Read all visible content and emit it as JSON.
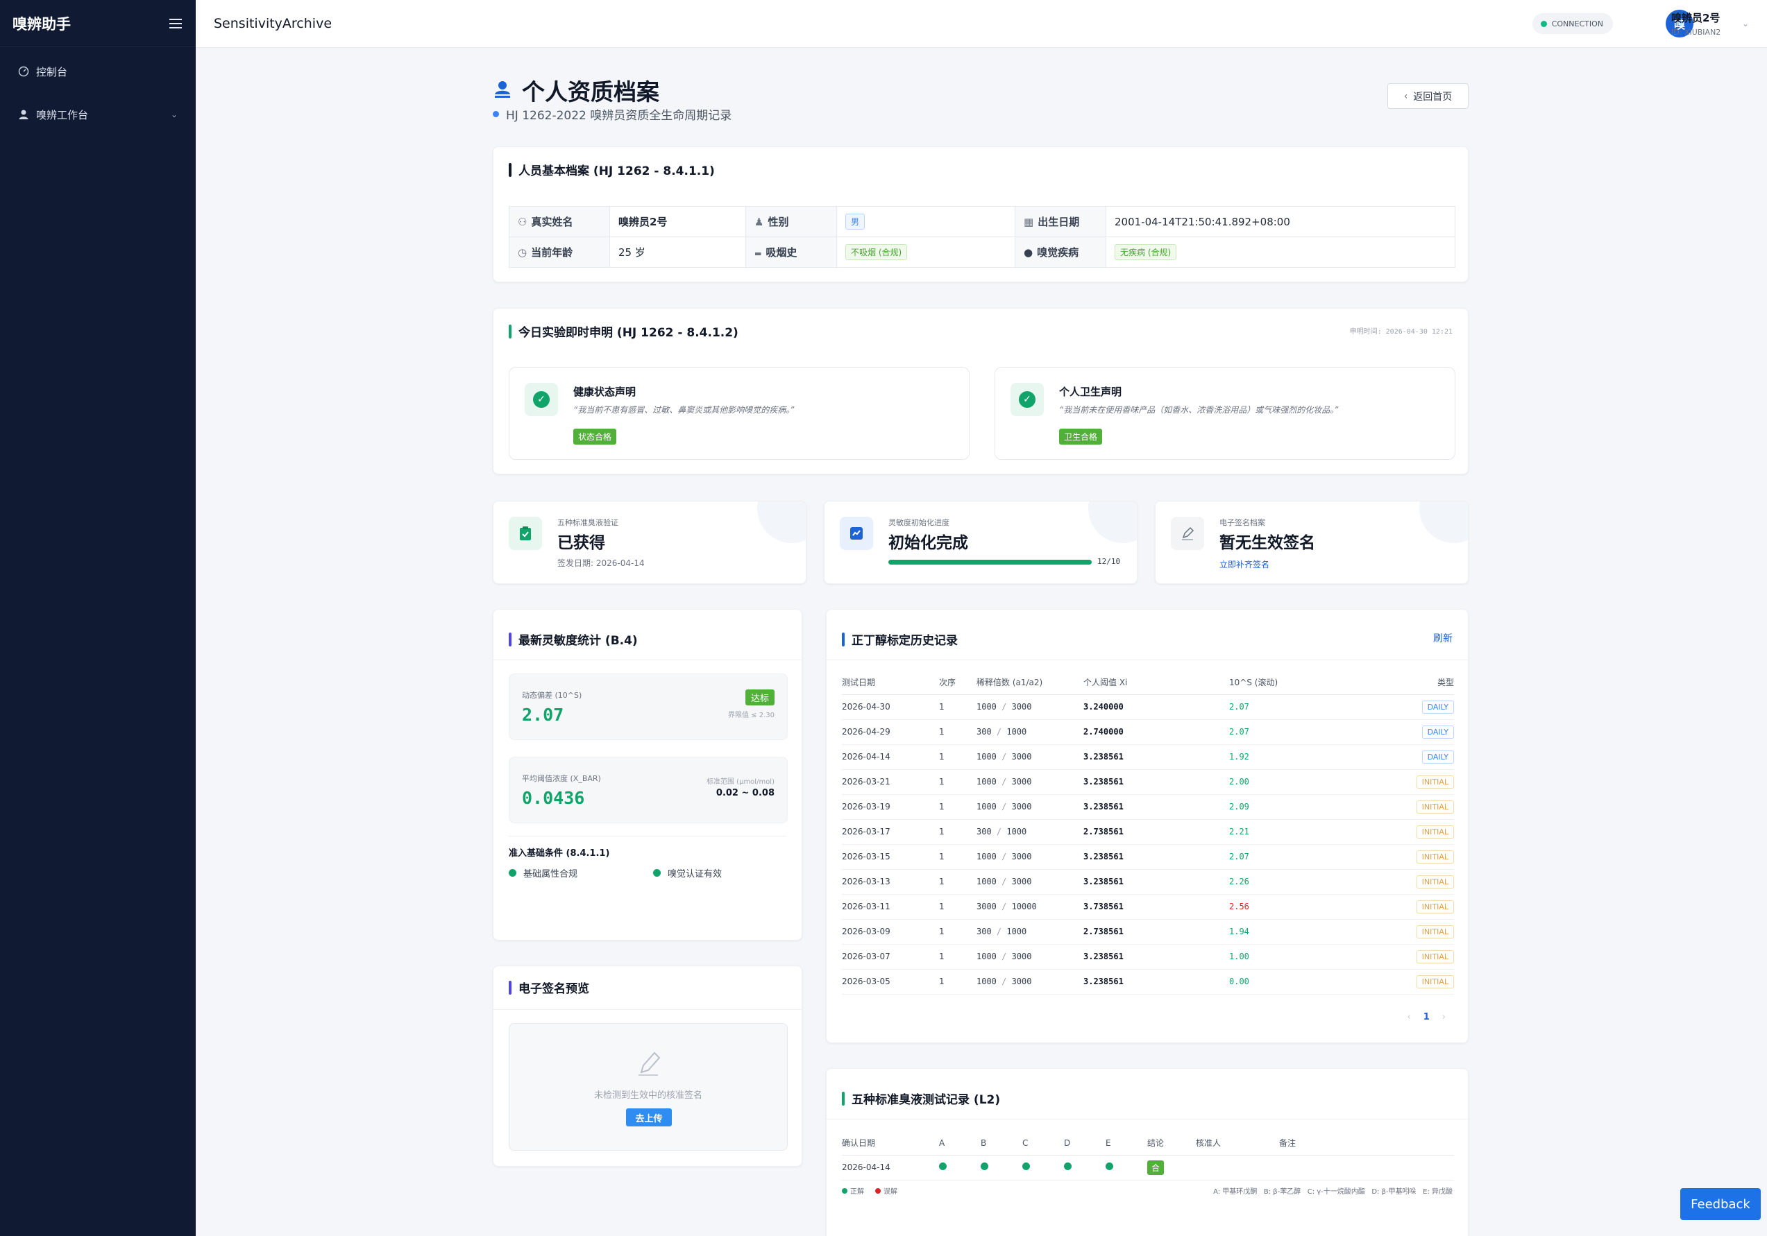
{
  "sidebar": {
    "brand": "嗅辨助手",
    "items": [
      {
        "label": "控制台"
      },
      {
        "label": "嗅辨工作台"
      }
    ]
  },
  "header": {
    "app_name": "SensitivityArchive",
    "connection": "CONNECTION",
    "avatar_char": "嗅",
    "user_name": "嗅辨员2号",
    "user_id": "ID: XIUBIAN2"
  },
  "page": {
    "title": "个人资质档案",
    "subtitle": "HJ 1262-2022 嗅辨员资质全生命周期记录",
    "back_label": "返回首页"
  },
  "basic": {
    "title": "人员基本档案 (HJ 1262 - 8.4.1.1)",
    "name_label": "真实姓名",
    "name": "嗅辨员2号",
    "gender_label": "性别",
    "gender": "男",
    "birth_label": "出生日期",
    "birth": "2001-04-14T21:50:41.892+08:00",
    "age_label": "当前年龄",
    "age": "25 岁",
    "smoke_label": "吸烟史",
    "smoke": "不吸烟 (合规)",
    "disease_label": "嗅觉疾病",
    "disease": "无疾病 (合规)"
  },
  "declaration": {
    "title": "今日实验即时申明 (HJ 1262 - 8.4.1.2)",
    "time": "申明时间: 2026-04-30 12:21",
    "health": {
      "title": "健康状态声明",
      "quote": "“我当前不患有感冒、过敏、鼻窦炎或其他影响嗅觉的疾病。”",
      "tag": "状态合格"
    },
    "hygiene": {
      "title": "个人卫生声明",
      "quote": "“我当前未在使用香味产品（如香水、浓香洗浴用品）或气味强烈的化妆品。”",
      "tag": "卫生合格"
    }
  },
  "stats": {
    "odor": {
      "caption": "五种标准臭液验证",
      "value": "已获得",
      "sub": "签发日期: 2026-04-14"
    },
    "init": {
      "caption": "灵敏度初始化进度",
      "value": "初始化完成",
      "progress": 1.0,
      "count": "12/10"
    },
    "sign": {
      "caption": "电子签名档案",
      "value": "暂无生效签名",
      "link": "立即补齐签名"
    }
  },
  "sensitivity": {
    "title": "最新灵敏度统计 (B.4)",
    "dyn_label": "动态偏差 (10^S)",
    "dyn_value": "2.07",
    "dyn_badge": "达标",
    "dyn_limit": "界限值 ≤ 2.30",
    "avg_label": "平均阈值浓度 (X_BAR)",
    "avg_value": "0.0436",
    "range_label": "标准范围 (μmol/mol)",
    "range_value": "0.02 ~ 0.08",
    "cond_title": "准入基础条件 (8.4.1.1)",
    "cond1": "基础属性合规",
    "cond2": "嗅觉认证有效"
  },
  "signature": {
    "title": "电子签名预览",
    "empty": "未检测到生效中的核准签名",
    "upload": "去上传"
  },
  "history": {
    "title": "正丁醇标定历史记录",
    "refresh": "刷新",
    "columns": [
      "测试日期",
      "次序",
      "稀释倍数 (a1/a2)",
      "个人阈值 Xi",
      "10^S (滚动)",
      "类型"
    ],
    "rows": [
      {
        "date": "2026-04-30",
        "seq": "1",
        "a1": "1000",
        "a2": "3000",
        "xi": "3.240000",
        "s": "2.07",
        "type": "DAILY"
      },
      {
        "date": "2026-04-29",
        "seq": "1",
        "a1": "300",
        "a2": "1000",
        "xi": "2.740000",
        "s": "2.07",
        "type": "DAILY"
      },
      {
        "date": "2026-04-14",
        "seq": "1",
        "a1": "1000",
        "a2": "3000",
        "xi": "3.238561",
        "s": "1.92",
        "type": "DAILY"
      },
      {
        "date": "2026-03-21",
        "seq": "1",
        "a1": "1000",
        "a2": "3000",
        "xi": "3.238561",
        "s": "2.00",
        "type": "INITIAL"
      },
      {
        "date": "2026-03-19",
        "seq": "1",
        "a1": "1000",
        "a2": "3000",
        "xi": "3.238561",
        "s": "2.09",
        "type": "INITIAL"
      },
      {
        "date": "2026-03-17",
        "seq": "1",
        "a1": "300",
        "a2": "1000",
        "xi": "2.738561",
        "s": "2.21",
        "type": "INITIAL"
      },
      {
        "date": "2026-03-15",
        "seq": "1",
        "a1": "1000",
        "a2": "3000",
        "xi": "3.238561",
        "s": "2.07",
        "type": "INITIAL"
      },
      {
        "date": "2026-03-13",
        "seq": "1",
        "a1": "1000",
        "a2": "3000",
        "xi": "3.238561",
        "s": "2.26",
        "type": "INITIAL"
      },
      {
        "date": "2026-03-11",
        "seq": "1",
        "a1": "3000",
        "a2": "10000",
        "xi": "3.738561",
        "s": "2.56",
        "type": "INITIAL"
      },
      {
        "date": "2026-03-09",
        "seq": "1",
        "a1": "300",
        "a2": "1000",
        "xi": "2.738561",
        "s": "1.94",
        "type": "INITIAL"
      },
      {
        "date": "2026-03-07",
        "seq": "1",
        "a1": "1000",
        "a2": "3000",
        "xi": "3.238561",
        "s": "1.00",
        "type": "INITIAL"
      },
      {
        "date": "2026-03-05",
        "seq": "1",
        "a1": "1000",
        "a2": "3000",
        "xi": "3.238561",
        "s": "0.00",
        "type": "INITIAL"
      }
    ],
    "page": "1"
  },
  "odor_tests": {
    "title": "五种标准臭液测试记录 (L2)",
    "columns": [
      "确认日期",
      "A",
      "B",
      "C",
      "D",
      "E",
      "结论",
      "核准人",
      "备注"
    ],
    "row": {
      "date": "2026-04-14",
      "result": "合"
    },
    "legend_ok": "正解",
    "legend_err": "误解",
    "keys": "A: 甲基环戊酮   B: β-苯乙醇   C: γ-十一烷酸内酯   D: β-甲基吲哚   E: 异戊酸"
  },
  "feedback": "Feedback",
  "colors": {
    "sidebar": "#101a33",
    "accent": "#1d63d8",
    "success": "#10a36a",
    "warn": "#e0a14a",
    "danger": "#dc2626"
  }
}
